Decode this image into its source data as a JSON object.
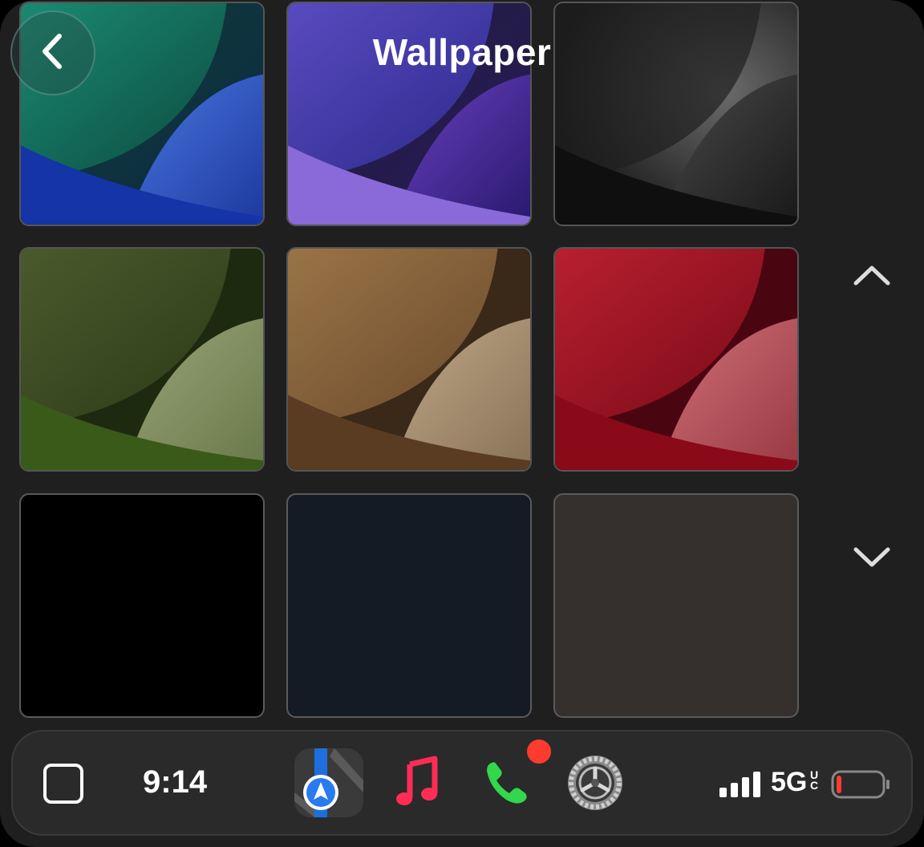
{
  "header": {
    "title": "Wallpaper",
    "back_icon": "chevron-left-icon"
  },
  "wallpapers": [
    {
      "name": "teal-blue",
      "colors": [
        "#0d5a4d",
        "#2a4aa8",
        "#1b2a6b"
      ]
    },
    {
      "name": "purple",
      "colors": [
        "#2a2a5a",
        "#6a4ab8",
        "#3a2a8a"
      ]
    },
    {
      "name": "graphite",
      "colors": [
        "#2a2a2a",
        "#777777",
        "#1a1a1a"
      ]
    },
    {
      "name": "olive-green",
      "colors": [
        "#3d4a24",
        "#8c9a6a",
        "#2d3a18"
      ]
    },
    {
      "name": "tan-brown",
      "colors": [
        "#7a5a34",
        "#b09a7a",
        "#4a3420"
      ]
    },
    {
      "name": "red",
      "colors": [
        "#a01a24",
        "#c06068",
        "#6a0a14"
      ]
    },
    {
      "name": "black",
      "colors": [
        "#000000"
      ]
    },
    {
      "name": "navy",
      "colors": [
        "#141b24"
      ]
    },
    {
      "name": "warm-gray",
      "colors": [
        "#35302d"
      ]
    }
  ],
  "scroll": {
    "up_icon": "chevron-up-icon",
    "down_icon": "chevron-down-icon"
  },
  "dock": {
    "time": "9:14",
    "apps": [
      {
        "name": "maps-app-icon"
      },
      {
        "name": "music-app-icon"
      },
      {
        "name": "phone-app-icon",
        "badge": true
      },
      {
        "name": "settings-app-icon"
      }
    ],
    "status": {
      "network": "5G",
      "network_suffix_top": "U",
      "network_suffix_bottom": "C",
      "signal_bars": 4,
      "battery_level": 0.1,
      "battery_color": "#ff3b30"
    }
  }
}
